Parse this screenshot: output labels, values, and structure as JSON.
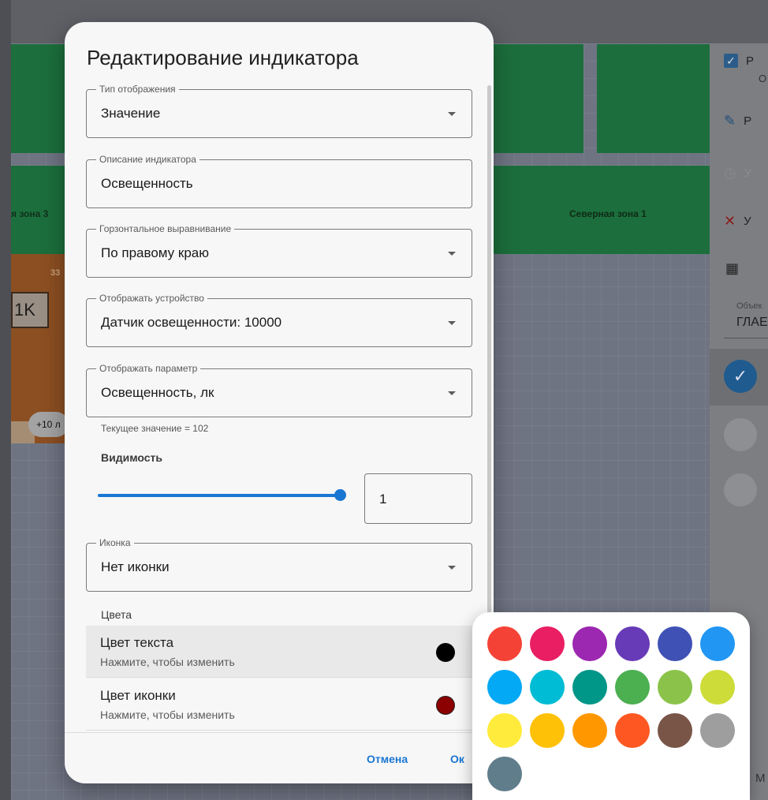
{
  "background": {
    "zones": [
      "я зона 3",
      "Северная зона 1"
    ],
    "card_number": "33",
    "card_tag": "1K",
    "card_chip": "+10 л",
    "right_panel": {
      "item_1_title": "Р",
      "item_1_sub": "О",
      "item_2": "Р",
      "item_3": "У",
      "item_4": "У",
      "object_label": "Объек",
      "object_value": "ГЛАЕ",
      "bottom_text": "М"
    }
  },
  "dialog": {
    "title": "Редактирование индикатора",
    "display_type": {
      "label": "Тип отображения",
      "value": "Значение"
    },
    "description": {
      "label": "Описание индикатора",
      "value": "Освещенность"
    },
    "alignment": {
      "label": "Горзонтальное выравнивание",
      "value": "По правому краю"
    },
    "device": {
      "label": "Отображать устройство",
      "value": "Датчик освещенности: 10000"
    },
    "parameter": {
      "label": "Отображать параметр",
      "value": "Освещенность, лк",
      "helper": "Текущее значение = 102"
    },
    "visibility": {
      "label": "Видимость",
      "value": "1",
      "slider_fraction": 1.0
    },
    "icon": {
      "label": "Иконка",
      "value": "Нет иконки"
    },
    "colors": {
      "section_label": "Цвета",
      "text_color": {
        "title": "Цвет текста",
        "subtitle": "Нажмите, чтобы изменить",
        "color": "#000000"
      },
      "icon_color": {
        "title": "Цвет иконки",
        "subtitle": "Нажмите, чтобы изменить",
        "color": "#8b0000"
      }
    },
    "actions": {
      "cancel": "Отмена",
      "ok": "Ок"
    }
  },
  "picker": {
    "swatches": [
      "#f44336",
      "#e91e63",
      "#9c27b0",
      "#673ab7",
      "#3f51b5",
      "#2196f3",
      "#03a9f4",
      "#00bcd4",
      "#009688",
      "#4caf50",
      "#8bc34a",
      "#cddc39",
      "#ffeb3b",
      "#ffc107",
      "#ff9800",
      "#ff5722",
      "#795548",
      "#9e9e9e",
      "#607d8b"
    ]
  },
  "accent": "#1976d2"
}
